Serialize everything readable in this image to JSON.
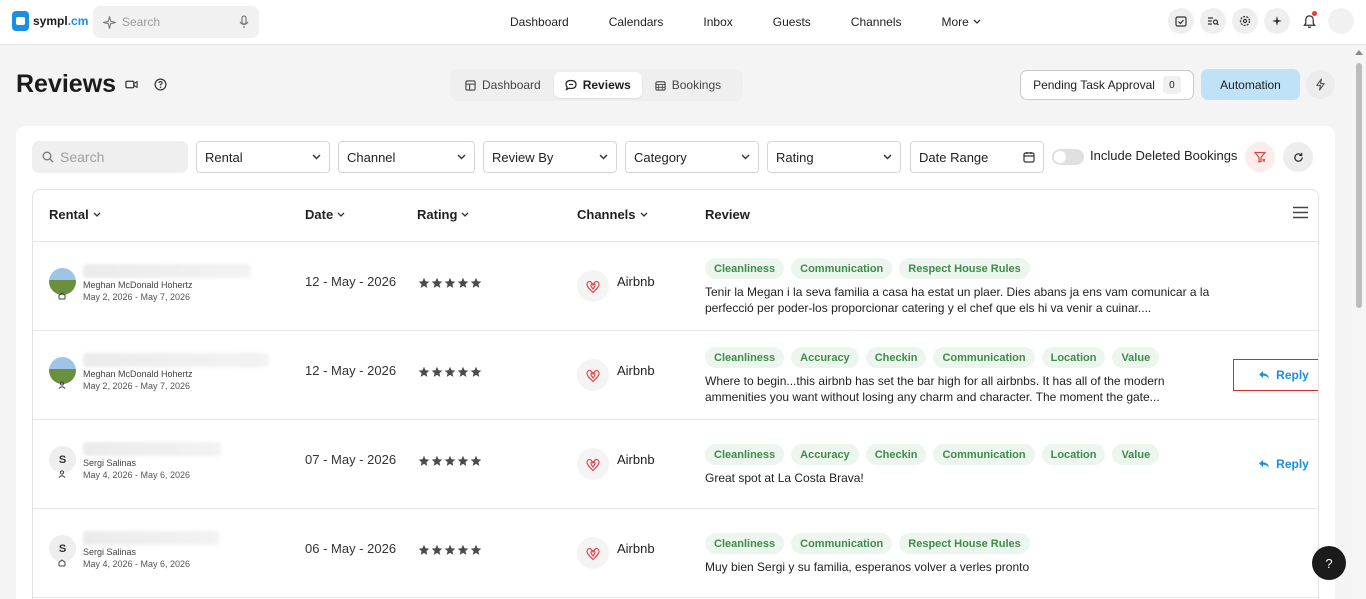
{
  "brand": {
    "name": "sympl",
    "tld": ".cm"
  },
  "top_search": {
    "placeholder": "Search"
  },
  "nav": {
    "dashboard": "Dashboard",
    "calendars": "Calendars",
    "inbox": "Inbox",
    "guests": "Guests",
    "channels": "Channels",
    "more": "More"
  },
  "page": {
    "title": "Reviews"
  },
  "view_switch": {
    "dashboard": "Dashboard",
    "reviews": "Reviews",
    "bookings": "Bookings"
  },
  "actions": {
    "pending_label": "Pending Task Approval",
    "pending_count": "0",
    "automation": "Automation"
  },
  "filters": {
    "search_placeholder": "Search",
    "rental": "Rental",
    "channel": "Channel",
    "review_by": "Review By",
    "category": "Category",
    "rating": "Rating",
    "date_range": "Date Range",
    "include_deleted": "Include Deleted Bookings"
  },
  "columns": {
    "rental": "Rental",
    "date": "Date",
    "rating": "Rating",
    "channels": "Channels",
    "review": "Review"
  },
  "rows": [
    {
      "avatar_initial": "",
      "guest": "Meghan McDonald Hohertz",
      "stay": "May 2, 2026 - May 7, 2026",
      "date": "12 - May - 2026",
      "channel": "Airbnb",
      "tags": [
        "Cleanliness",
        "Communication",
        "Respect House Rules"
      ],
      "text": "Tenir la Megan i la seva familia a casa ha estat un plaer. Dies abans ja ens vam comunicar a la perfecció per poder-los proporcionar catering y el chef que els hi va venir a cuinar....",
      "reply": ""
    },
    {
      "avatar_initial": "",
      "guest": "Meghan McDonald Hohertz",
      "stay": "May 2, 2026 - May 7, 2026",
      "date": "12 - May - 2026",
      "channel": "Airbnb",
      "tags": [
        "Cleanliness",
        "Accuracy",
        "Checkin",
        "Communication",
        "Location",
        "Value"
      ],
      "text": "Where to begin...this airbnb has set the bar high for all airbnbs. It has all of the modern ammenities you want without losing any charm and character. The moment the gate...",
      "reply": "Reply"
    },
    {
      "avatar_initial": "S",
      "guest": "Sergi Salinas",
      "stay": "May 4, 2026 - May 6, 2026",
      "date": "07 - May - 2026",
      "channel": "Airbnb",
      "tags": [
        "Cleanliness",
        "Accuracy",
        "Checkin",
        "Communication",
        "Location",
        "Value"
      ],
      "text": "Great spot at La Costa Brava!",
      "reply": "Reply"
    },
    {
      "avatar_initial": "S",
      "guest": "Sergi Salinas",
      "stay": "May 4, 2026 - May 6, 2026",
      "date": "06 - May - 2026",
      "channel": "Airbnb",
      "tags": [
        "Cleanliness",
        "Communication",
        "Respect House Rules"
      ],
      "text": "Muy bien Sergi y su familia, esperanos volver a verles pronto",
      "reply": ""
    }
  ],
  "help": {
    "label": "?"
  },
  "colors": {
    "accent": "#1a8fe3",
    "tag_text": "#3f8b49",
    "tag_bg": "#edf6ee",
    "highlight": "#d62b2b",
    "automation_bg": "#bfe2f7"
  }
}
